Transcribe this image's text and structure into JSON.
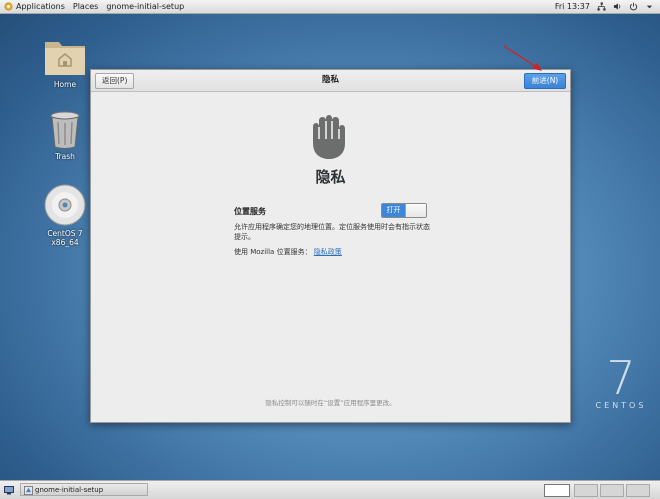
{
  "topbar": {
    "applications": "Applications",
    "places": "Places",
    "app_name": "gnome-initial-setup",
    "clock": "Fri 13:37"
  },
  "desktop": {
    "icons": [
      {
        "label": "Home"
      },
      {
        "label": "Trash"
      },
      {
        "label": "CentOS 7 x86_64"
      }
    ],
    "branding": {
      "number": "7",
      "text": "CENTOS"
    }
  },
  "dialog": {
    "back_label": "返回(P)",
    "title": "隐私",
    "next_label": "前进(N)",
    "heading": "隐私",
    "location_label": "位置服务",
    "switch_label": "打开",
    "switch_on": true,
    "description": "允许应用程序确定您的地理位置。定位服务使用时会有指示状态提示。",
    "mozilla_text": "使用 Mozilla 位置服务：",
    "privacy_link": "隐私政策",
    "footnote": "隐私控制可以随时在“设置”应用程序里更改。"
  },
  "bottombar": {
    "task_label": "gnome-initial-setup"
  },
  "colors": {
    "accent": "#3d86d8",
    "annotation": "#d62020"
  }
}
